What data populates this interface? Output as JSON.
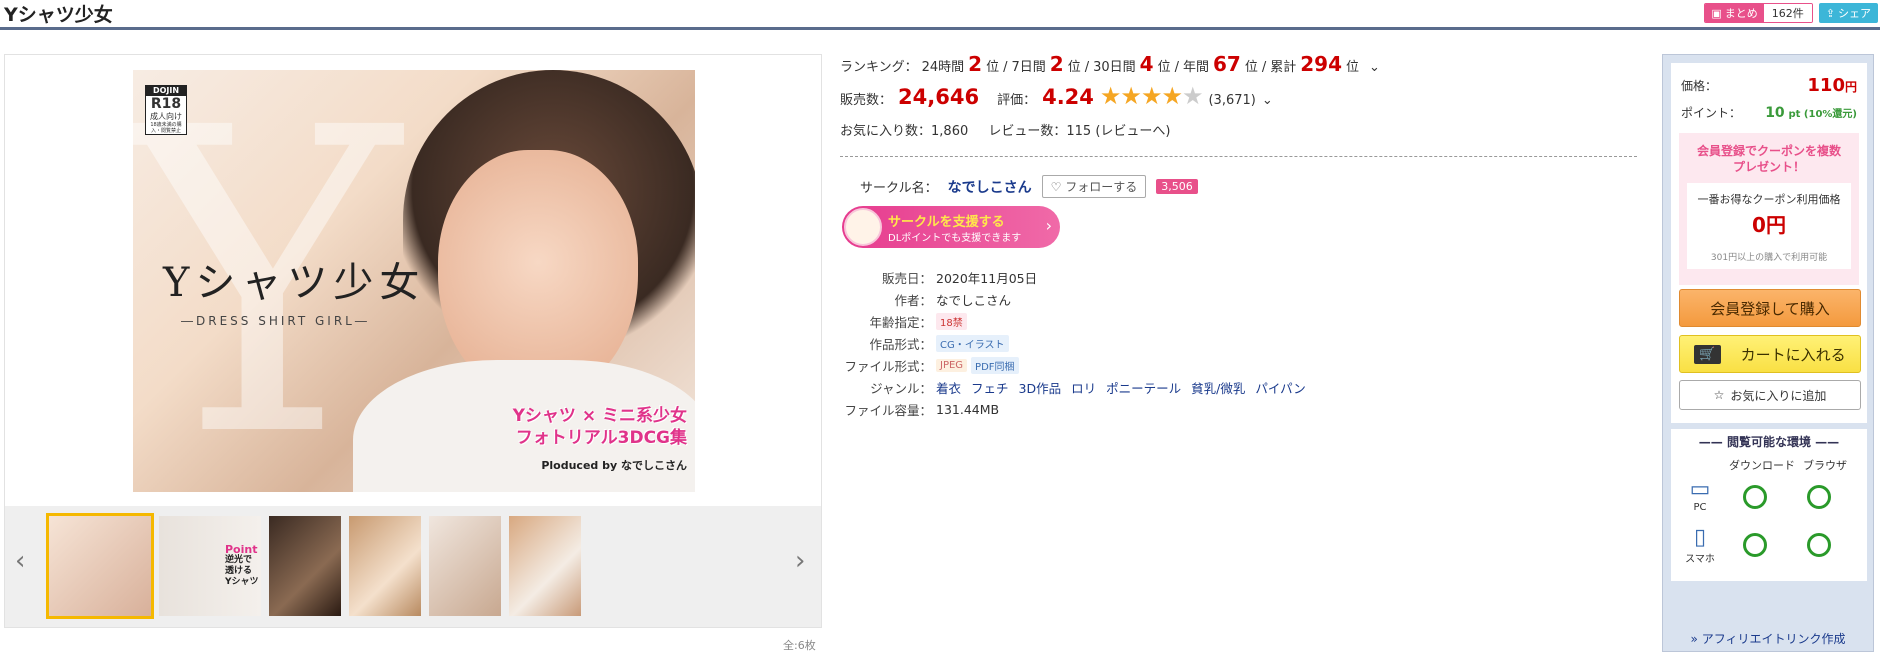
{
  "title": "Yシャツ少女",
  "header": {
    "matome_label": "まとめ",
    "matome_count": "162件",
    "share_label": "シェア"
  },
  "cover": {
    "badge_top": "DOJIN",
    "badge_r18": "R18",
    "badge_mid": "成人向け",
    "badge_small": "18歳未満の購入・閲覧禁止",
    "title": "Yシャツ少女",
    "subtitle": "―DRESS SHIRT GIRL―",
    "catch1": "Yシャツ × ミニ系少女",
    "catch2": "フォトリアル3DCG集",
    "produced_prefix": "Ploduced by",
    "produced_name": "なでしこさん"
  },
  "thumb2": {
    "line1": "Point",
    "line2": "逆光で",
    "line3": "透ける",
    "line4": "Yシャツ"
  },
  "gallery_count": "全:6枚",
  "ranking": {
    "label": "ランキング：",
    "items": [
      {
        "period": "24時間",
        "rank": "2",
        "unit": "位"
      },
      {
        "period": "7日間",
        "rank": "2",
        "unit": "位"
      },
      {
        "period": "30日間",
        "rank": "4",
        "unit": "位"
      },
      {
        "period": "年間",
        "rank": "67",
        "unit": "位"
      },
      {
        "period": "累計",
        "rank": "294",
        "unit": "位"
      }
    ]
  },
  "sales": {
    "label": "販売数：",
    "count": "24,646",
    "rating_label": "評価：",
    "rating": "4.24",
    "rating_value": 4.24,
    "rating_count": "(3,671)"
  },
  "favorites": {
    "label": "お気に入り数：",
    "count": "1,860",
    "review_label": "レビュー数：",
    "review_count": "115",
    "review_link": "(レビューへ)"
  },
  "circle": {
    "label": "サークル名：",
    "name": "なでしこさん",
    "follow_label": "フォローする",
    "follower_count": "3,506"
  },
  "support": {
    "line1": "サークルを支援する",
    "line2": "DLポイントでも支援できます"
  },
  "details": {
    "release_label": "販売日：",
    "release": "2020年11月05日",
    "author_label": "作者：",
    "author": "なでしこさん",
    "age_label": "年齢指定：",
    "age": "18禁",
    "format_label": "作品形式：",
    "format": "CG・イラスト",
    "filetype_label": "ファイル形式：",
    "filetype1": "JPEG",
    "filetype2": "PDF同梱",
    "genre_label": "ジャンル：",
    "genres": [
      "着衣",
      "フェチ",
      "3D作品",
      "ロリ",
      "ポニーテール",
      "貧乳/微乳",
      "パイパン"
    ],
    "size_label": "ファイル容量：",
    "size": "131.44MB"
  },
  "sidebar": {
    "price_label": "価格：",
    "price": "110",
    "price_unit": "円",
    "point_label": "ポイント：",
    "points": "10",
    "points_unit": "pt (10%還元)",
    "coupon_line1": "会員登録でクーポンを複数",
    "coupon_line2": "プレゼント！",
    "coupon_price_label": "一番お得なクーポン利用価格",
    "coupon_price": "0",
    "coupon_price_unit": "円",
    "coupon_note": "301円以上の購入で利用可能",
    "register_buy": "会員登録して購入",
    "add_cart": "カートに入れる",
    "add_fav": "お気に入りに追加",
    "env_title": "閲覧可能な環境",
    "download": "ダウンロード",
    "browser": "ブラウザ",
    "pc": "PC",
    "smartphone": "スマホ",
    "affiliate": "» アフィリエイトリンク作成"
  }
}
